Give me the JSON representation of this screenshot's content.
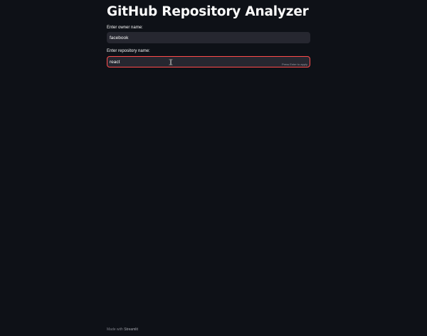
{
  "page": {
    "title": "GitHub Repository Analyzer"
  },
  "owner_field": {
    "label": "Enter owner name:",
    "value": "facebook"
  },
  "repo_field": {
    "label": "Enter repository name:",
    "value": "react",
    "hint": "Press Enter to apply"
  },
  "footer": {
    "prefix": "Made with",
    "brand": "Streamlit"
  },
  "colors": {
    "background": "#0e1117",
    "input_background": "#262730",
    "focus_border": "#ff4b4b",
    "text": "#fafafa"
  },
  "icons": {
    "mouse_cursor": "text-cursor-icon"
  }
}
